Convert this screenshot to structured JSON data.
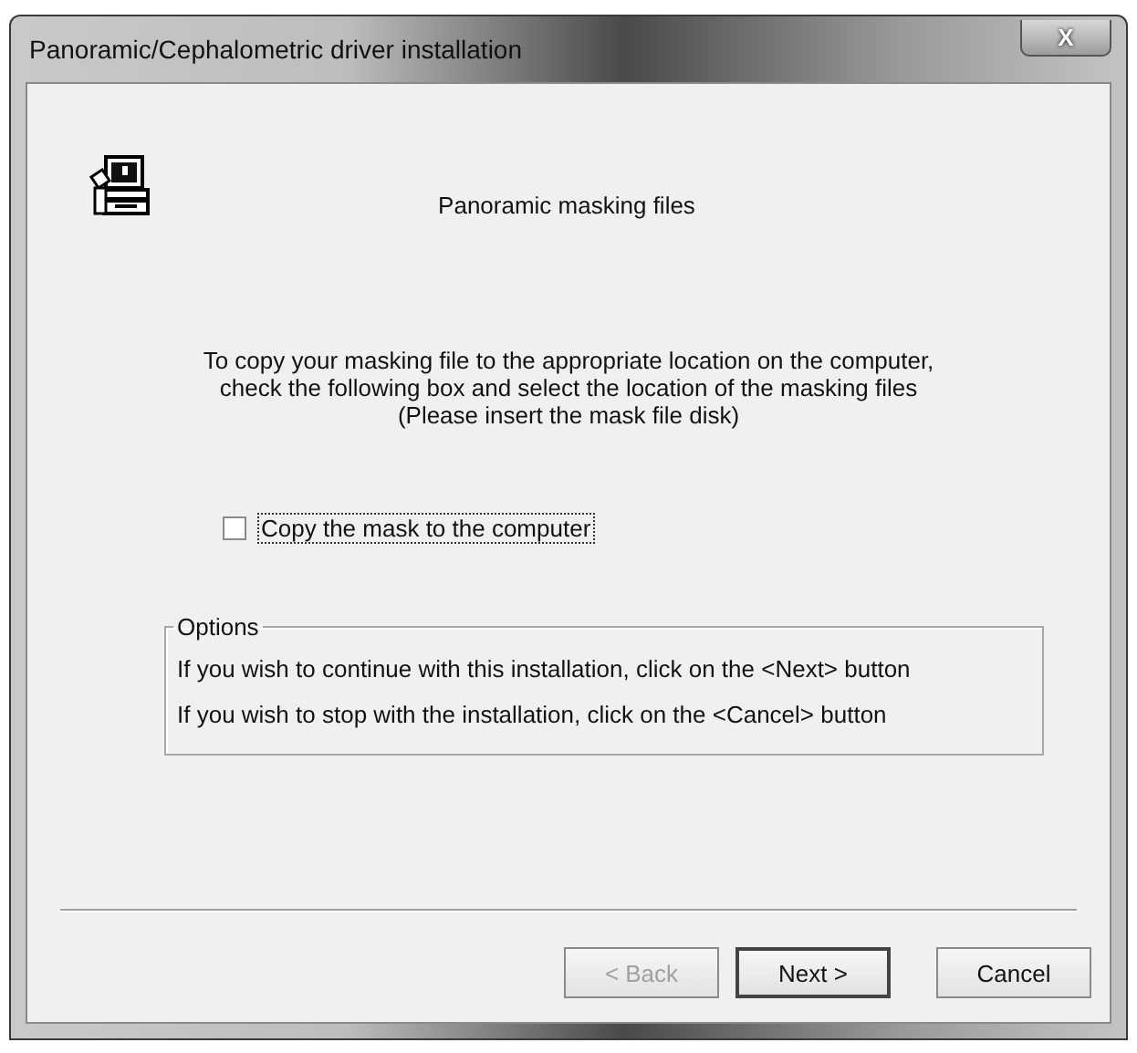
{
  "window": {
    "title": "Panoramic/Cephalometric driver installation",
    "close": "X"
  },
  "heading": "Panoramic masking files",
  "instructions": [
    "To copy your masking file to the appropriate location on the computer,",
    "check the following box and select the location of the masking files",
    "(Please insert the mask file disk)"
  ],
  "checkbox": {
    "label": "Copy the mask to the computer",
    "checked": false,
    "focused": true
  },
  "options": {
    "title": "Options",
    "lines": [
      "If you wish to continue with this installation, click on the <Next> button",
      "If you wish to stop with the installation, click on the <Cancel> button"
    ]
  },
  "buttons": [
    {
      "label": "< Back",
      "disabled": true,
      "default": false
    },
    {
      "label": "Next >",
      "disabled": false,
      "default": true
    },
    {
      "label": "Cancel",
      "disabled": false,
      "default": false
    }
  ]
}
